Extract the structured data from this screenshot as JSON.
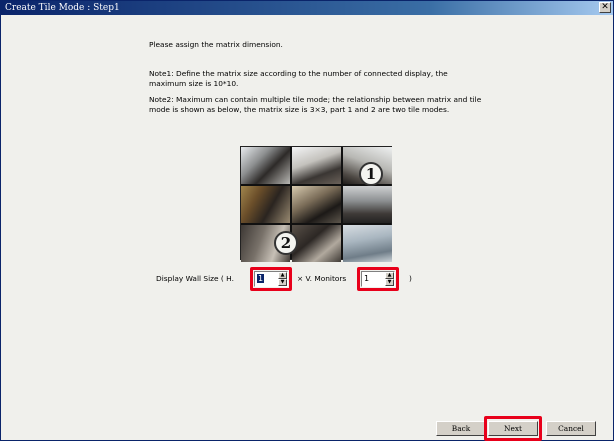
{
  "window": {
    "title": "Create Tile Mode : Step1",
    "close_glyph": "✕"
  },
  "instructions": {
    "line1": "Please assign the matrix dimension.",
    "note1_a": "Note1: Define the matrix size according to the number of connected display, the",
    "note1_b": "maximum size is 10*10.",
    "note2_a": "Note2: Maximum can contain multiple tile mode; the relationship between matrix and tile",
    "note2_b": "mode is shown as below, the matrix size is 3×3, part 1 and 2 are two tile modes."
  },
  "diagram": {
    "marker1": "1",
    "marker2": "2"
  },
  "wall_size": {
    "label": "Display Wall Size ( H.",
    "h_value": "1",
    "x_label": "×  V. Monitors",
    "v_value": "1",
    "close": ")"
  },
  "buttons": {
    "back": "Back",
    "next": "Next",
    "cancel": "Cancel"
  },
  "colors": {
    "highlight": "#e8001a",
    "titlebar": "#0a246a"
  }
}
